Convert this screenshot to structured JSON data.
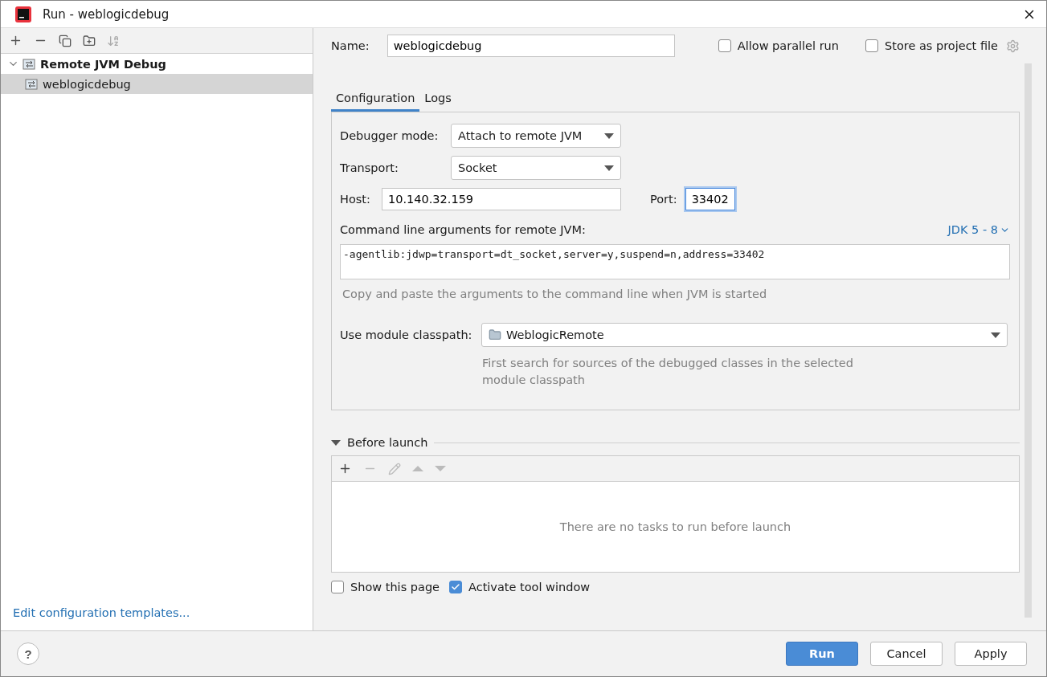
{
  "window": {
    "title": "Run - weblogicdebug"
  },
  "tree": [
    {
      "label": "Remote JVM Debug",
      "expanded": true,
      "selected": false,
      "children": [
        {
          "label": "weblogicdebug",
          "selected": true
        }
      ]
    }
  ],
  "edit_templates_link": "Edit configuration templates...",
  "name": {
    "label": "Name:",
    "value": "weblogicdebug"
  },
  "allow_parallel": {
    "label": "Allow parallel run",
    "checked": false
  },
  "store_project": {
    "label": "Store as project file",
    "checked": false
  },
  "tabs": [
    {
      "label": "Configuration",
      "selected": true
    },
    {
      "label": "Logs",
      "selected": false
    }
  ],
  "debugger_mode": {
    "label": "Debugger mode:",
    "value": "Attach to remote JVM"
  },
  "transport": {
    "label": "Transport:",
    "value": "Socket"
  },
  "host": {
    "label": "Host:",
    "value": "10.140.32.159"
  },
  "port": {
    "label": "Port:",
    "value": "33402"
  },
  "cmd": {
    "label": "Command line arguments for remote JVM:",
    "jdk": "JDK 5 - 8",
    "value": "-agentlib:jdwp=transport=dt_socket,server=y,suspend=n,address=33402",
    "hint": "Copy and paste the arguments to the command line when JVM is started"
  },
  "module": {
    "label": "Use module classpath:",
    "value": "WeblogicRemote",
    "hint": "First search for sources of the debugged classes in the selected module classpath"
  },
  "before_launch": {
    "title": "Before launch",
    "expanded": true,
    "empty": "There are no tasks to run before launch"
  },
  "options": [
    {
      "label": "Show this page",
      "checked": false
    },
    {
      "label": "Activate tool window",
      "checked": true
    }
  ],
  "help": "?",
  "buttons": [
    {
      "label": "Run",
      "kind": "primary"
    },
    {
      "label": "Cancel",
      "kind": "normal"
    },
    {
      "label": "Apply",
      "kind": "normal"
    }
  ]
}
